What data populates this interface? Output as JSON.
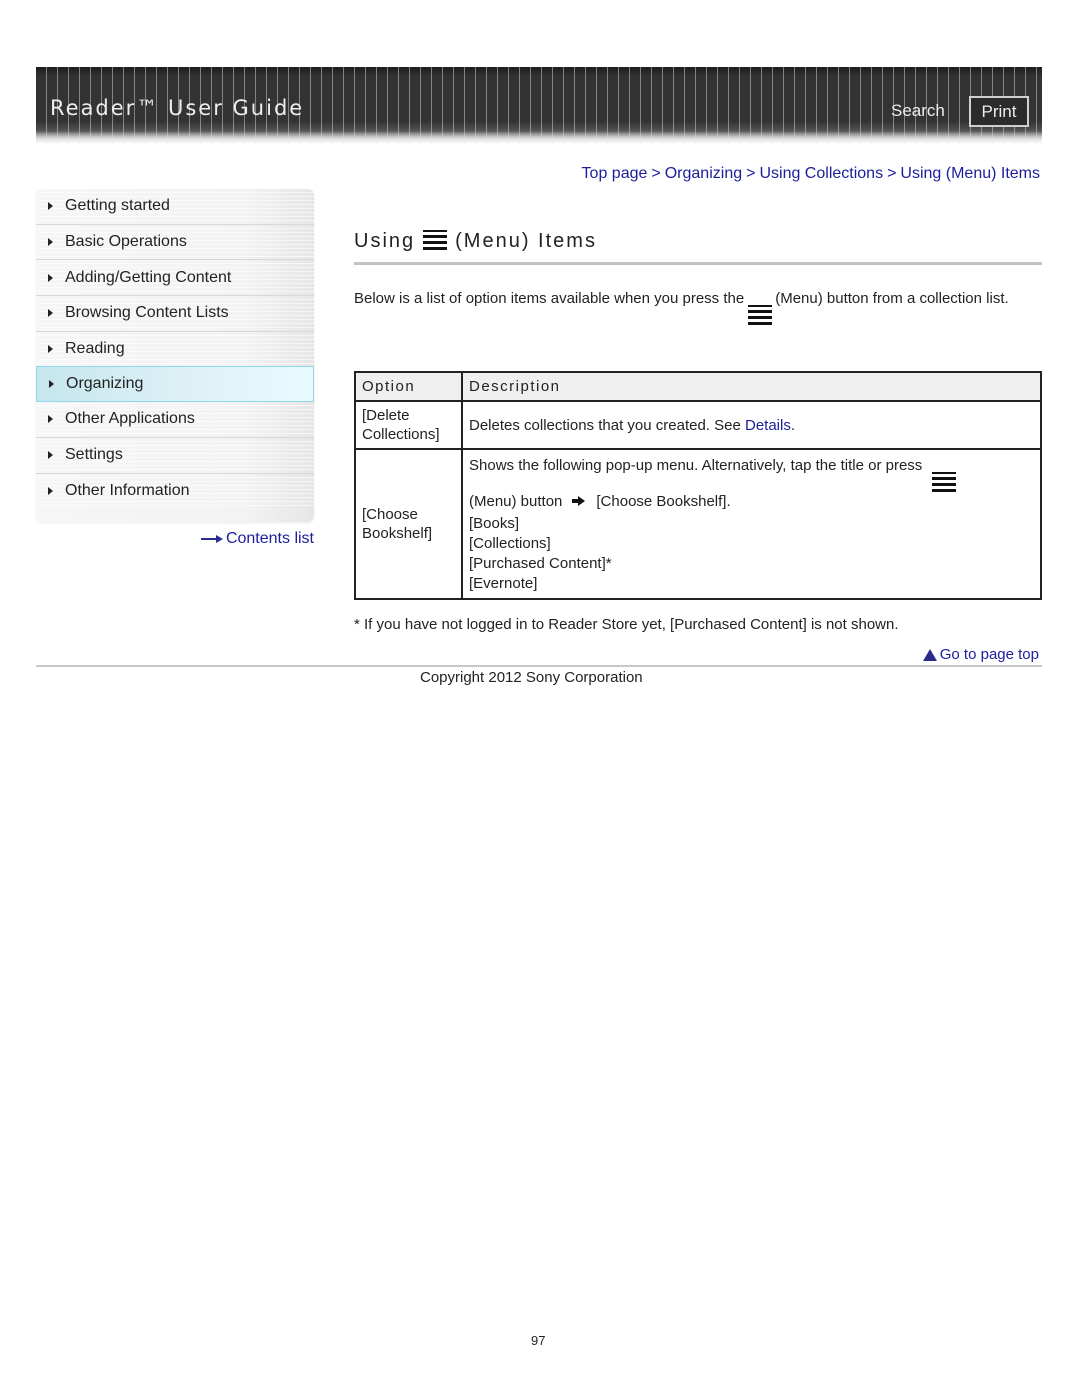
{
  "header": {
    "title": "Reader™ User Guide",
    "search_label": "Search",
    "print_label": "Print"
  },
  "breadcrumb": {
    "items": [
      "Top page",
      "Organizing",
      "Using Collections",
      "Using (Menu) Items"
    ],
    "separator": ">"
  },
  "sidebar": {
    "items": [
      {
        "label": "Getting started",
        "active": false
      },
      {
        "label": "Basic Operations",
        "active": false
      },
      {
        "label": "Adding/Getting Content",
        "active": false
      },
      {
        "label": "Browsing Content Lists",
        "active": false
      },
      {
        "label": "Reading",
        "active": false
      },
      {
        "label": "Organizing",
        "active": true
      },
      {
        "label": "Other Applications",
        "active": false
      },
      {
        "label": "Settings",
        "active": false
      },
      {
        "label": "Other Information",
        "active": false
      }
    ],
    "contents_link": "Contents list"
  },
  "main": {
    "title_before": "Using",
    "title_after": "(Menu) Items",
    "intro_before": "Below is a list of option items available when you press the",
    "intro_after": "(Menu) button from a collection list.",
    "table": {
      "headers": [
        "Option",
        "Description"
      ],
      "rows": [
        {
          "option": "[Delete Collections]",
          "description_text": "Deletes collections that you created. See ",
          "description_link": "Details",
          "description_end": "."
        },
        {
          "option": "[Choose Bookshelf]",
          "description_line1": "Shows the following pop-up menu. Alternatively, tap the title or press",
          "description_line2_before": "(Menu) button",
          "description_line2_after": "[Choose Bookshelf].",
          "sub_items": [
            "[Books]",
            "[Collections]",
            "[Purchased Content]*",
            "[Evernote]"
          ]
        }
      ]
    },
    "footnote": "* If you have not logged in to Reader Store yet, [Purchased Content] is not shown.",
    "go_to_top": "Go to page top"
  },
  "footer": {
    "copyright": "Copyright 2012 Sony Corporation",
    "page_number": "97"
  },
  "colors": {
    "link": "#1d1d9c",
    "header_bg": "#2e2e2e",
    "active_nav": "#d2eef4"
  }
}
